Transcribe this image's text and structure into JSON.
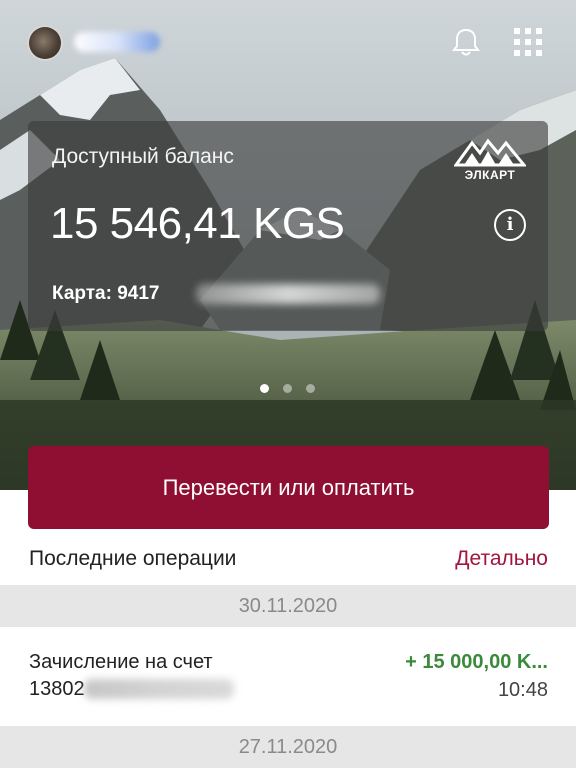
{
  "header": {
    "avatar_icon": "user-avatar",
    "notifications_icon": "bell-icon",
    "menu_icon": "grid-menu-icon"
  },
  "card": {
    "label": "Доступный баланс",
    "brand": "ЭЛКАРТ",
    "balance": "15 546,41 KGS",
    "info_symbol": "i",
    "card_number": "Карта: 9417"
  },
  "carousel": {
    "pages": 3,
    "active_page": 1
  },
  "actions": {
    "primary_label": "Перевести или оплатить"
  },
  "operations": {
    "title": "Последние операции",
    "detail_link": "Детально",
    "groups": [
      {
        "date": "30.11.2020",
        "items": [
          {
            "title": "Зачисление на счет",
            "account": "13802",
            "amount": "+ 15 000,00 K...",
            "time": "10:48"
          }
        ]
      },
      {
        "date": "27.11.2020"
      }
    ]
  },
  "colors": {
    "primary": "#8e0f32",
    "link": "#a2153e",
    "positive": "#3b8a3b",
    "date_bar": "#e6e6e6"
  }
}
